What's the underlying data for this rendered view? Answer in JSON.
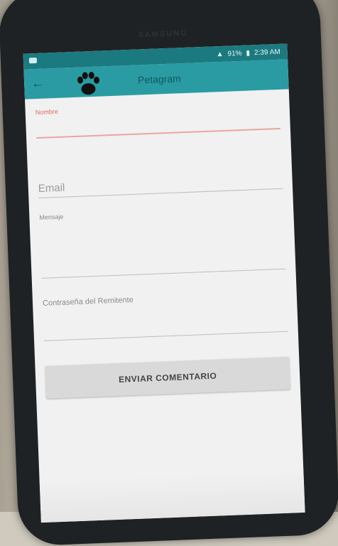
{
  "status_bar": {
    "battery": "91%",
    "time": "2:39 AM"
  },
  "phone_brand": "SAMSUNG",
  "toolbar": {
    "title": "Petagram",
    "back_icon": "arrow-left-icon",
    "logo_icon": "paw-icon"
  },
  "form": {
    "name_label": "Nombre",
    "name_value": "",
    "email_placeholder": "Email",
    "message_label": "Mensaje",
    "password_label": "Contraseña del Remitente",
    "submit_label": "ENVIAR COMENTARIO"
  },
  "colors": {
    "status": "#1b7a80",
    "toolbar": "#2a9ba3",
    "accent": "#e06a5e"
  }
}
